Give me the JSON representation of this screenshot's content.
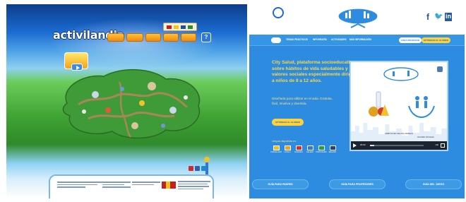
{
  "left_site": {
    "logo": "activilandia",
    "nav": [
      "",
      "",
      "",
      "",
      ""
    ],
    "help_icon": "?",
    "flag_colors": [
      "#c81e1e",
      "#f0c414",
      "#1f4fa0",
      "#2a8c3a"
    ],
    "social_colors": [
      "#d02a2a",
      "#3b5ba8",
      "#1e8ad6"
    ],
    "footer_columns": [
      {
        "title": ""
      },
      {
        "title": ""
      },
      {
        "title": ""
      },
      {
        "title": ""
      }
    ]
  },
  "right_site": {
    "header": {
      "social_icons": [
        "f",
        "🐦",
        "in"
      ]
    },
    "nav": {
      "home": "",
      "items": [
        "TEMAS PRÁCTICOS",
        "INFOGRAFÍA",
        "ACTIVIDADES",
        "MÁS INFORMACIÓN"
      ],
      "button_primary": "ZONA PROFESOR",
      "button_accent": "OPTIMIZAR AL ALUMNO"
    },
    "hero": {
      "title": "City Salud, plataforma socioeducativa sobre hábitos de vida saludables y valores sociales especialmente dirigida a niños de 8 a 12 años.",
      "subtitle": "Diseñada para utilizar en el aula. Gratuita, fácil, intuitiva y divertida.",
      "cta": "OPTIMIZAR AL ALUMNO"
    },
    "languages": {
      "label": "Lenguas disponibles en:",
      "items": [
        {
          "name": "CASTELLANO",
          "color": "#e8c21c"
        },
        {
          "name": "CATALÀ",
          "color": "#e8a41c"
        },
        {
          "name": "EUSKARA",
          "color": "#d92c2c"
        },
        {
          "name": "GALEGO",
          "color": "#3a78d0"
        },
        {
          "name": "PORTUGUÊS",
          "color": "#2a9a3a"
        },
        {
          "name": "ENGLISH",
          "color": "#2b3e8c"
        }
      ]
    },
    "video": {
      "caption": "HÁBITOS DE VIDA SALUDABLES",
      "right_caption": "VALORES SOCIALES",
      "time": "00:00",
      "progress": 0.08,
      "hd": "HD"
    },
    "guides": [
      "GUÍA PARA PADRES",
      "GUÍA PARA PROFESORES",
      "GUÍA DEL JUEGO"
    ]
  }
}
